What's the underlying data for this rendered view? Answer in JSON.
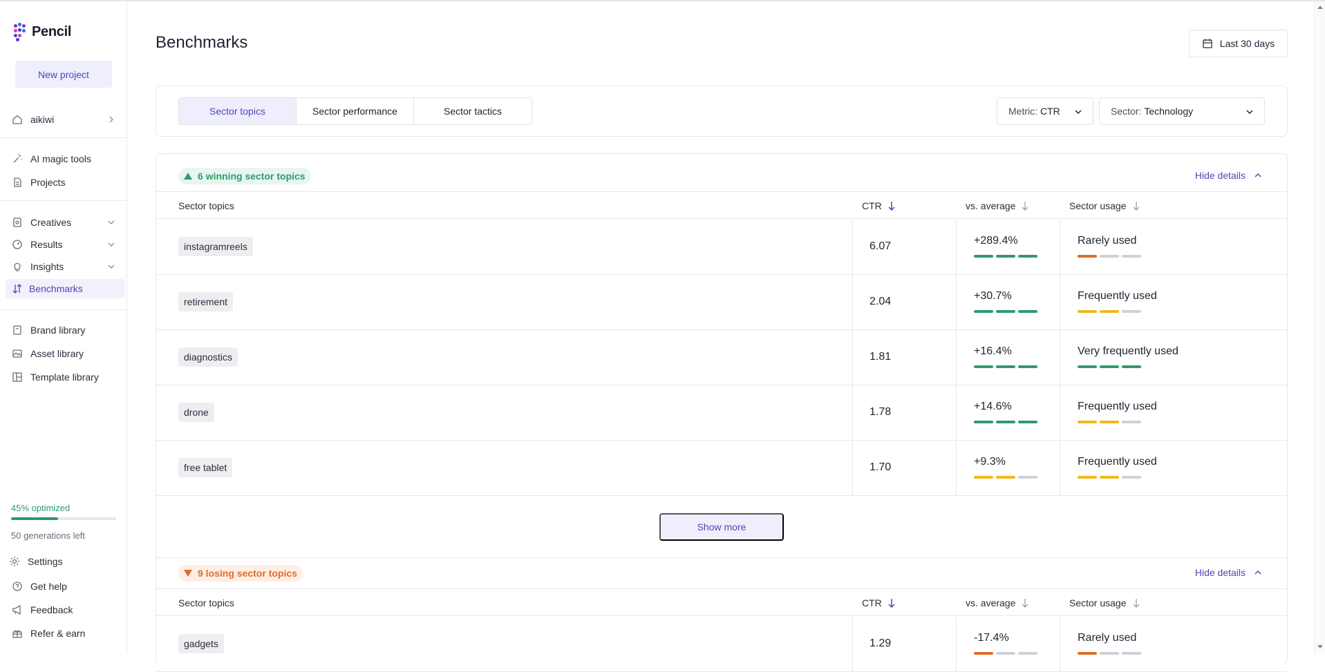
{
  "app": {
    "name": "Pencil"
  },
  "sidebar": {
    "new_project": "New project",
    "workspace": "aikiwi",
    "items": [
      {
        "label": "AI magic tools",
        "icon": "magic-wand-icon"
      },
      {
        "label": "Projects",
        "icon": "document-icon"
      },
      {
        "label": "Creatives",
        "icon": "creative-icon"
      },
      {
        "label": "Results",
        "icon": "gauge-icon"
      },
      {
        "label": "Insights",
        "icon": "lightbulb-icon"
      },
      {
        "label": "Benchmarks",
        "icon": "sort-arrows-icon"
      },
      {
        "label": "Brand library",
        "icon": "brand-book-icon"
      },
      {
        "label": "Asset library",
        "icon": "image-icon"
      },
      {
        "label": "Template library",
        "icon": "layout-icon"
      }
    ],
    "optimized_label": "45% optimized",
    "optimized_value": 45,
    "generations_left": "50 generations left",
    "footer": [
      {
        "label": "Settings",
        "icon": "gear-icon"
      },
      {
        "label": "Get help",
        "icon": "help-icon"
      },
      {
        "label": "Feedback",
        "icon": "megaphone-icon"
      },
      {
        "label": "Refer & earn",
        "icon": "gift-icon"
      }
    ]
  },
  "header": {
    "title": "Benchmarks",
    "date_range": "Last 30 days"
  },
  "filters": {
    "tabs": [
      "Sector topics",
      "Sector performance",
      "Sector tactics"
    ],
    "active_tab": 0,
    "metric_label": "Metric:",
    "metric_value": "CTR",
    "sector_label": "Sector:",
    "sector_value": "Technology"
  },
  "columns": {
    "topic": "Sector topics",
    "ctr": "CTR",
    "vs": "vs. average",
    "usage": "Sector usage"
  },
  "colors": {
    "green": "#2f9a6c",
    "orange": "#e06d2a",
    "yellow": "#f2b81a",
    "gray": "#cfd1d8",
    "accent": "#4f46b8"
  },
  "winning": {
    "badge": "6 winning sector topics",
    "hide_details": "Hide details",
    "show_more": "Show more",
    "rows": [
      {
        "topic": "instagramreels",
        "ctr": "6.07",
        "vs": "+289.4%",
        "vs_bars": [
          "green",
          "green",
          "green"
        ],
        "usage": "Rarely used",
        "usage_bars": [
          "orange",
          "gray",
          "gray"
        ]
      },
      {
        "topic": "retirement",
        "ctr": "2.04",
        "vs": "+30.7%",
        "vs_bars": [
          "green",
          "green",
          "green"
        ],
        "usage": "Frequently used",
        "usage_bars": [
          "yellow",
          "yellow",
          "gray"
        ]
      },
      {
        "topic": "diagnostics",
        "ctr": "1.81",
        "vs": "+16.4%",
        "vs_bars": [
          "green",
          "green",
          "green"
        ],
        "usage": "Very frequently used",
        "usage_bars": [
          "green",
          "green",
          "green"
        ]
      },
      {
        "topic": "drone",
        "ctr": "1.78",
        "vs": "+14.6%",
        "vs_bars": [
          "green",
          "green",
          "green"
        ],
        "usage": "Frequently used",
        "usage_bars": [
          "yellow",
          "yellow",
          "gray"
        ]
      },
      {
        "topic": "free tablet",
        "ctr": "1.70",
        "vs": "+9.3%",
        "vs_bars": [
          "yellow",
          "yellow",
          "gray"
        ],
        "usage": "Frequently used",
        "usage_bars": [
          "yellow",
          "yellow",
          "gray"
        ]
      }
    ]
  },
  "losing": {
    "badge": "9 losing sector topics",
    "hide_details": "Hide details",
    "rows": [
      {
        "topic": "gadgets",
        "ctr": "1.29",
        "vs": "-17.4%",
        "vs_bars": [
          "orange",
          "gray",
          "gray"
        ],
        "usage": "Rarely used",
        "usage_bars": [
          "orange",
          "gray",
          "gray"
        ]
      }
    ]
  }
}
